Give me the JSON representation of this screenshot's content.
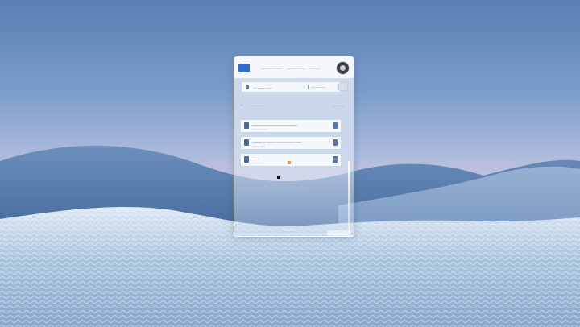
{
  "window": {
    "logo_text": "",
    "nav": [
      "———— ——",
      "———— —",
      "———"
    ],
    "search_label": "— —— ——",
    "search_label2": "——— —",
    "section_title": "—— ——",
    "section_count": "—— —",
    "rows": [
      {
        "name": "——— — ——— ——— ———",
        "meta": "——— — ——"
      },
      {
        "name": "——— — ——— ——— —— ——",
        "meta": "——— ——"
      },
      {
        "name": "——",
        "meta": "——— ——"
      }
    ]
  },
  "icons": {
    "logo": "app-logo-icon",
    "avatar": "user-avatar",
    "pin": "pin-icon",
    "send": "send-icon",
    "back": "back-arrow-icon",
    "doc": "document-icon",
    "status": "status-icon"
  },
  "colors": {
    "accent": "#2d6fd0",
    "sky_top": "#5a7fb3",
    "horizon": "#e9d7ea",
    "dune": "#4d76a8",
    "cursor_marker": "#f08a2a"
  }
}
